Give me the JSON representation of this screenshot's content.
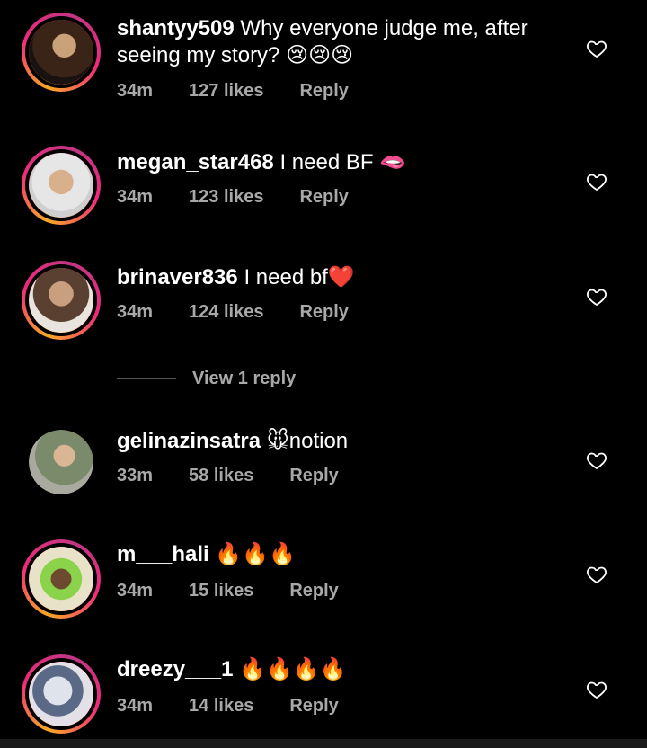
{
  "comments": [
    {
      "username": "shantyy509",
      "text_line1": "Why everyone judge me, after",
      "text_line2": "seeing my story? 😢😢😢",
      "time": "34m",
      "likes": "127 likes",
      "reply": "Reply"
    },
    {
      "username": "megan_star468",
      "text": "I need BF 🫦",
      "time": "34m",
      "likes": "123 likes",
      "reply": "Reply"
    },
    {
      "username": "brinaver836",
      "text": "I need bf❤️",
      "time": "34m",
      "likes": "124 likes",
      "reply": "Reply"
    },
    {
      "username": "gelinazinsatra",
      "text": "🐭notion",
      "time": "33m",
      "likes": "58 likes",
      "reply": "Reply"
    },
    {
      "username": "m___hali",
      "text": "🔥🔥🔥",
      "time": "34m",
      "likes": "15 likes",
      "reply": "Reply"
    },
    {
      "username": "dreezy___1",
      "text": "🔥🔥🔥🔥",
      "time": "34m",
      "likes": "14 likes",
      "reply": "Reply"
    }
  ],
  "view_replies": "View 1 reply",
  "colors": {
    "background": "#000000",
    "muted": "#a8a8a8",
    "story_ring_start": "#f9a825",
    "story_ring_end": "#c13584"
  },
  "icons": [
    "heart-outline-icon"
  ]
}
